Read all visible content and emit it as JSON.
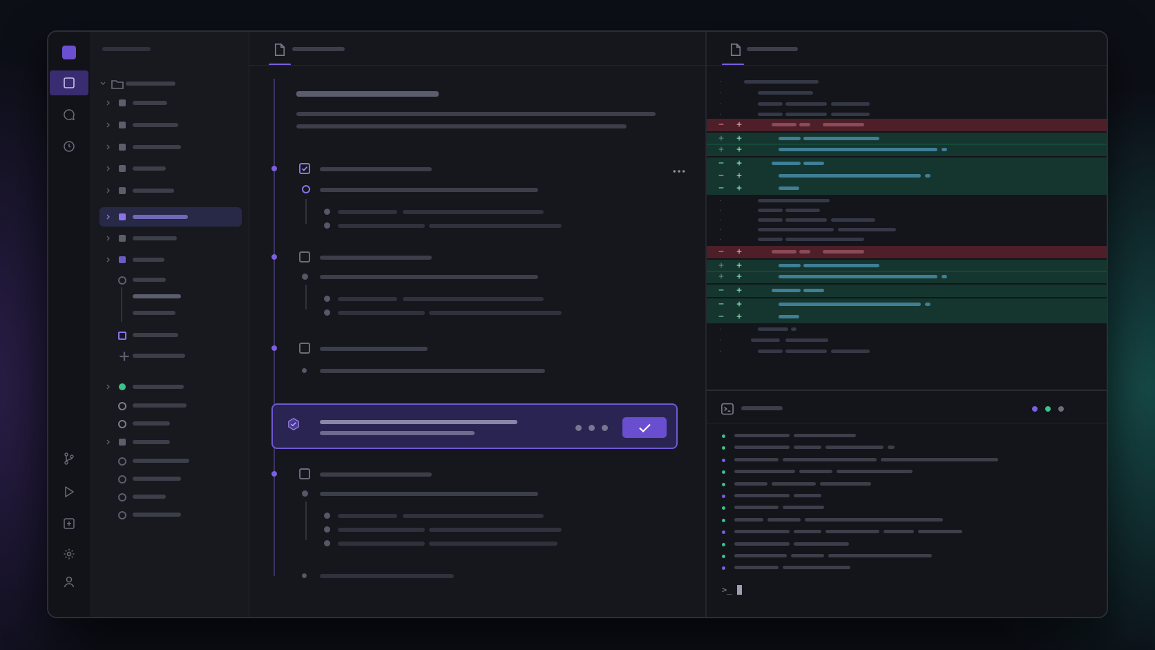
{
  "icons": {
    "rail": [
      "explorer-icon",
      "chat-icon",
      "history-icon",
      "source-control-icon",
      "run-icon",
      "extensions-icon",
      "settings-icon",
      "account-icon"
    ],
    "editor_tab": "file-icon",
    "diff_tab": "file-icon",
    "terminal_tab": "terminal-icon",
    "approval": "shield-check-icon",
    "approve": "check-icon",
    "more": "more-horizontal-icon"
  },
  "terminal": {
    "prompt": ">_"
  },
  "colors": {
    "accent": "#7b5fe0",
    "diff_deleted": "#a02d3c",
    "diff_added": "#195f46",
    "status_purple": "#7b5fe0",
    "status_green": "#3fbf8a",
    "status_gray": "#6a6d7a"
  }
}
